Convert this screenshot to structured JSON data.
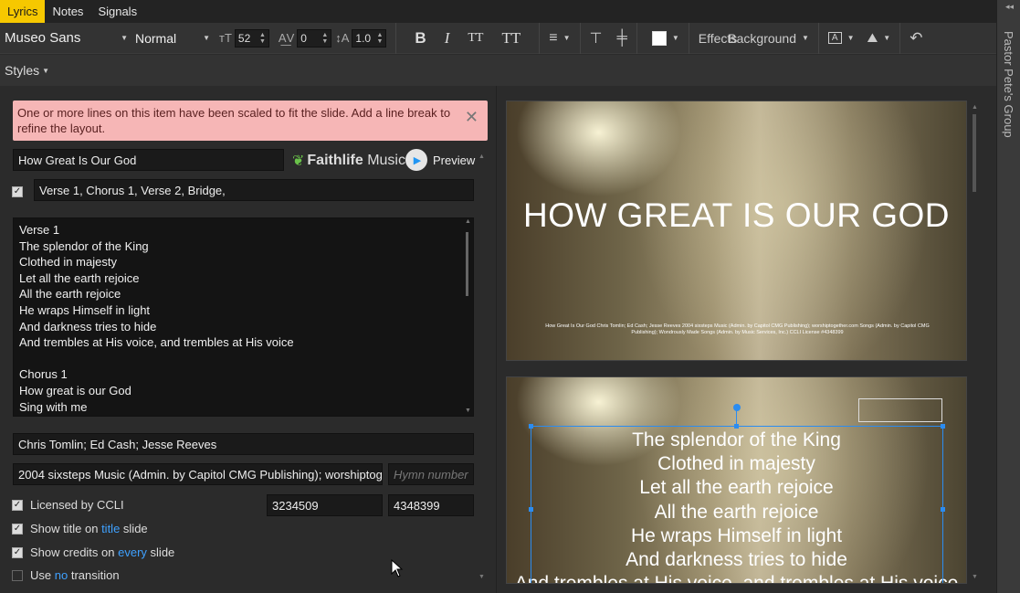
{
  "tabs": [
    {
      "label": "Lyrics",
      "active": true
    },
    {
      "label": "Notes",
      "active": false
    },
    {
      "label": "Signals",
      "active": false
    }
  ],
  "toolbar": {
    "font": "Museo Sans",
    "weight": "Normal",
    "font_size": "52",
    "spacing": "0",
    "line_height": "1.0",
    "bold": "B",
    "italic": "I",
    "small_caps": "TT",
    "all_caps": "TT",
    "effects_label": "Effects",
    "background_label": "Background",
    "text_color": "#ffffff"
  },
  "styles_label": "Styles",
  "side_panel_label": "Pastor Pete's Group",
  "alert": {
    "message": "One or more lines on this item have been scaled to fit the slide. Add a line break to refine the layout."
  },
  "song": {
    "title": "How Great Is Our God",
    "brand_prefix": "Faithlife",
    "brand_suffix": "Music",
    "preview_label": "Preview",
    "arrangement": "Verse 1, Chorus 1, Verse 2, Bridge,",
    "lyrics": [
      "Verse 1",
      "The splendor of the King",
      "Clothed in majesty",
      "Let all the earth rejoice",
      "All the earth rejoice",
      "He wraps Himself in light",
      "And darkness tries to hide",
      "And trembles at His voice, and trembles at His voice",
      "",
      "Chorus 1",
      "How great is our God",
      "Sing with me"
    ],
    "authors": "Chris Tomlin; Ed Cash; Jesse Reeves",
    "copyright": "2004 sixsteps Music (Admin. by Capitol CMG Publishing); worshiptog",
    "hymn_placeholder": "Hymn number",
    "ccli_song_number": "3234509",
    "ccli_license": "4348399"
  },
  "options": {
    "licensed_label": "Licensed by CCLI",
    "show_title_prefix": "Show title on",
    "show_title_link": "title",
    "show_title_suffix": "slide",
    "show_credits_prefix": "Show credits on",
    "show_credits_link": "every",
    "show_credits_suffix": "slide",
    "transition_prefix": "Use",
    "transition_link": "no",
    "transition_suffix": "transition",
    "licensed_checked": true,
    "show_title_checked": true,
    "show_credits_checked": true,
    "transition_checked": false
  },
  "slides": {
    "title_slide_text": "HOW GREAT IS OUR GOD",
    "credits_line1": "How Great Is Our God Chris Tomlin; Ed Cash; Jesse Reeves 2004 sixsteps Music (Admin. by Capitol CMG Publishing); worshiptogether.com Songs (Admin. by Capitol CMG",
    "credits_line2": "Publishing); Wondrously Made Songs (Admin. by Music Services, Inc.) CCLI License #4348399",
    "verse_lines": [
      "The splendor of the King",
      "Clothed in majesty",
      "Let all the earth rejoice",
      "All the earth rejoice",
      "He wraps Himself in light",
      "And darkness tries to hide",
      "And trembles at His voice, and trembles at His voice"
    ]
  },
  "colors": {
    "active_tab": "#f6c800",
    "alert_bg": "#f6b6b6",
    "link": "#3fa1ff",
    "selection": "#2b8cf0",
    "brand_leaf": "#6ac24a"
  }
}
